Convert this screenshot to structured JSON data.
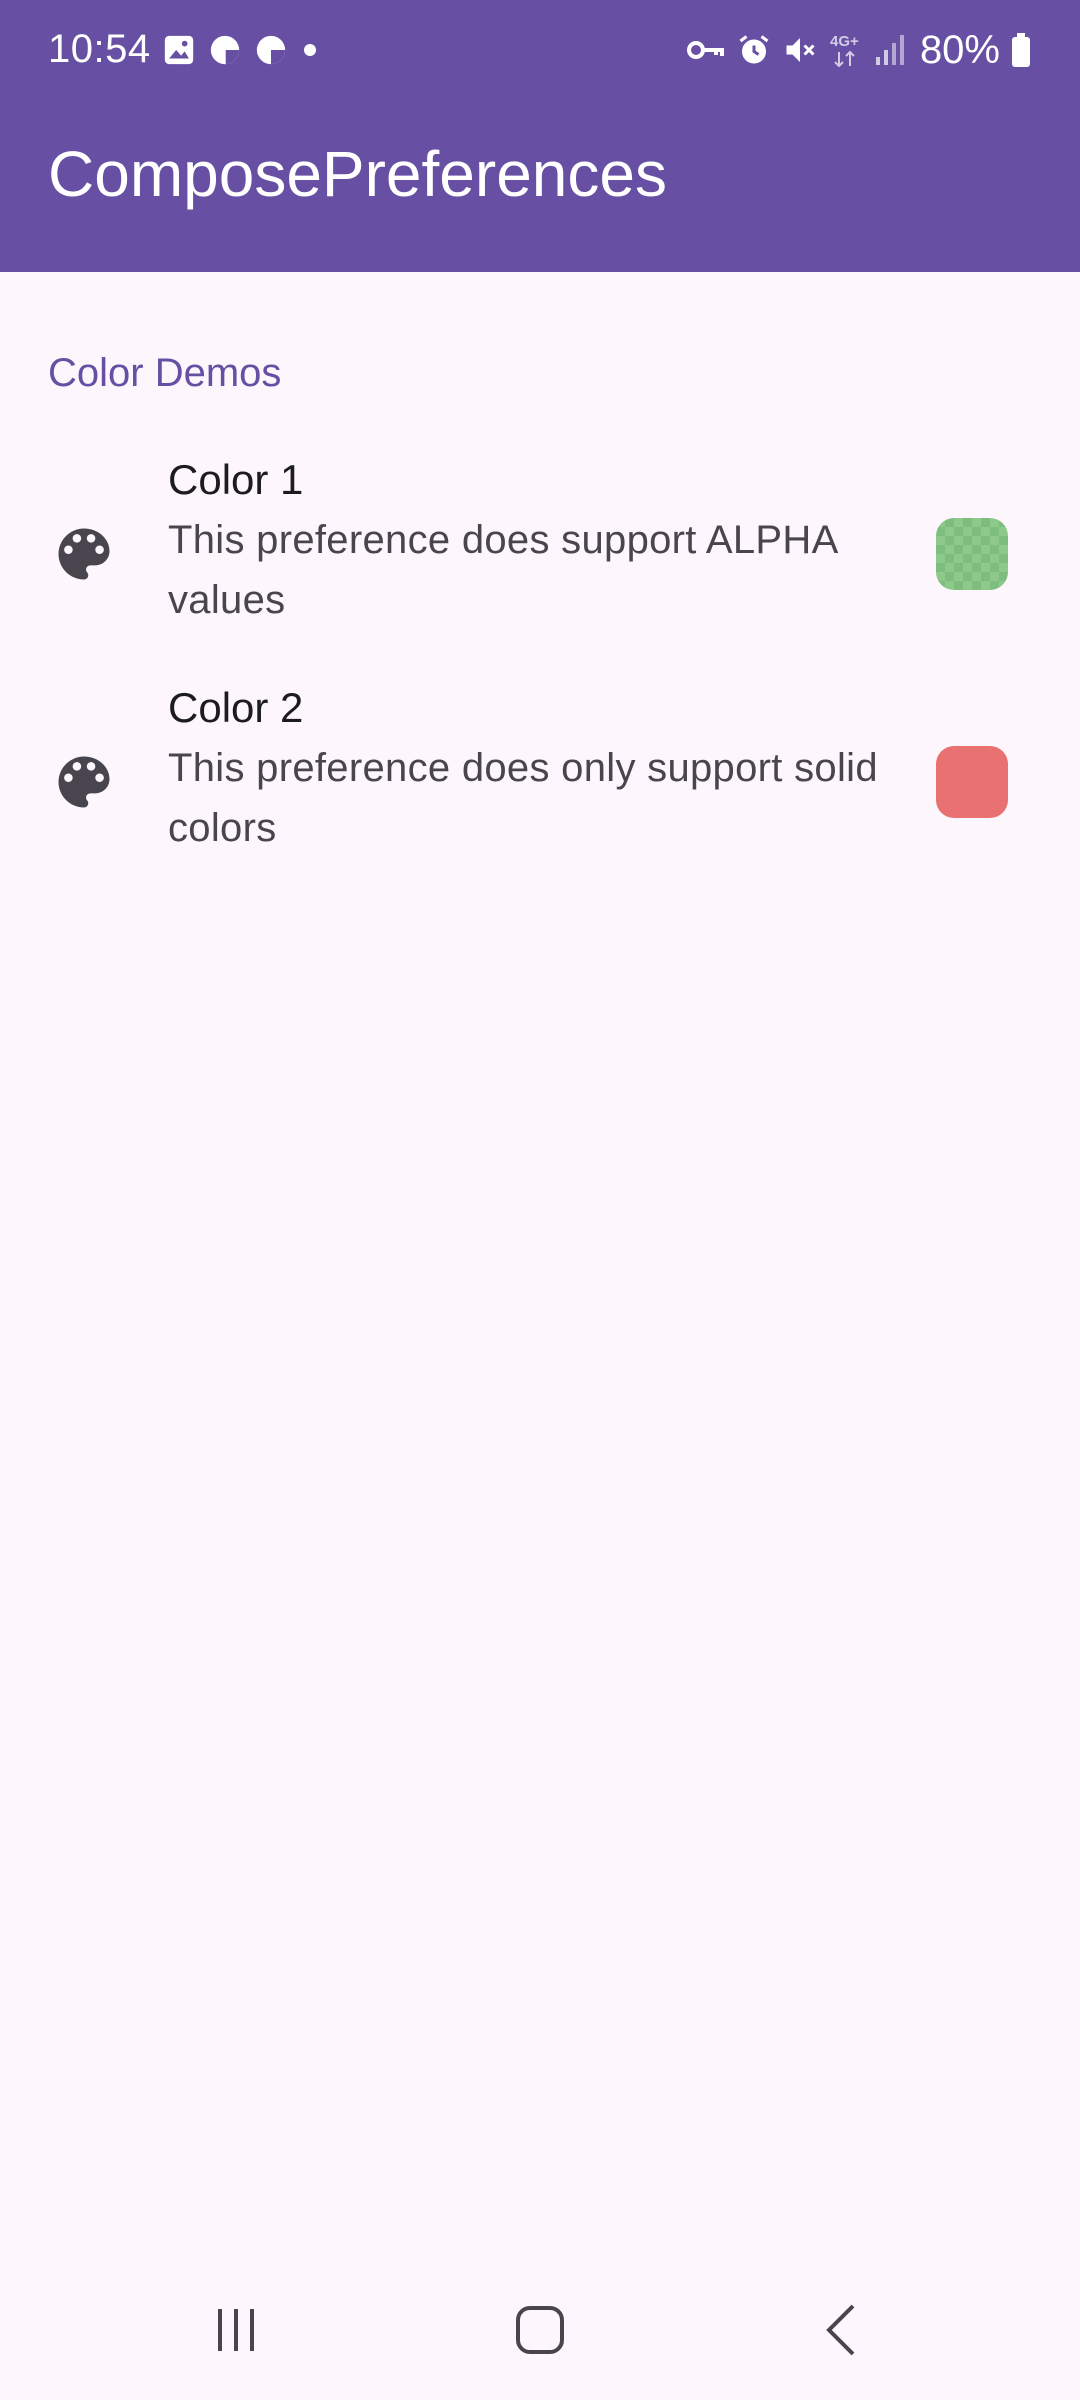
{
  "status_bar": {
    "time": "10:54",
    "battery": "80%",
    "left_icons": [
      "gallery-icon",
      "pie-status-icon",
      "pie-status-icon",
      "dot-icon"
    ],
    "right_icons": [
      "vpn-key-icon",
      "alarm-icon",
      "mute-icon",
      "4g-data-icon",
      "signal-icon",
      "battery-icon"
    ]
  },
  "app_bar": {
    "title": "ComposePreferences"
  },
  "section": {
    "title": "Color Demos"
  },
  "preferences": [
    {
      "title": "Color 1",
      "summary": "This preference does support ALPHA values",
      "icon": "palette-icon",
      "color": "#8cc98a",
      "alpha_checkered": true
    },
    {
      "title": "Color 2",
      "summary": "This preference does only support solid colors",
      "icon": "palette-icon",
      "color": "#ea7171",
      "alpha_checkered": false
    }
  ],
  "nav_bar": {
    "buttons": [
      "recents-icon",
      "home-icon",
      "back-icon"
    ]
  },
  "colors": {
    "primary": "#6750a4",
    "background": "#fdf7fd",
    "on_surface": "#1c1b1f",
    "on_surface_variant": "#49454f"
  }
}
